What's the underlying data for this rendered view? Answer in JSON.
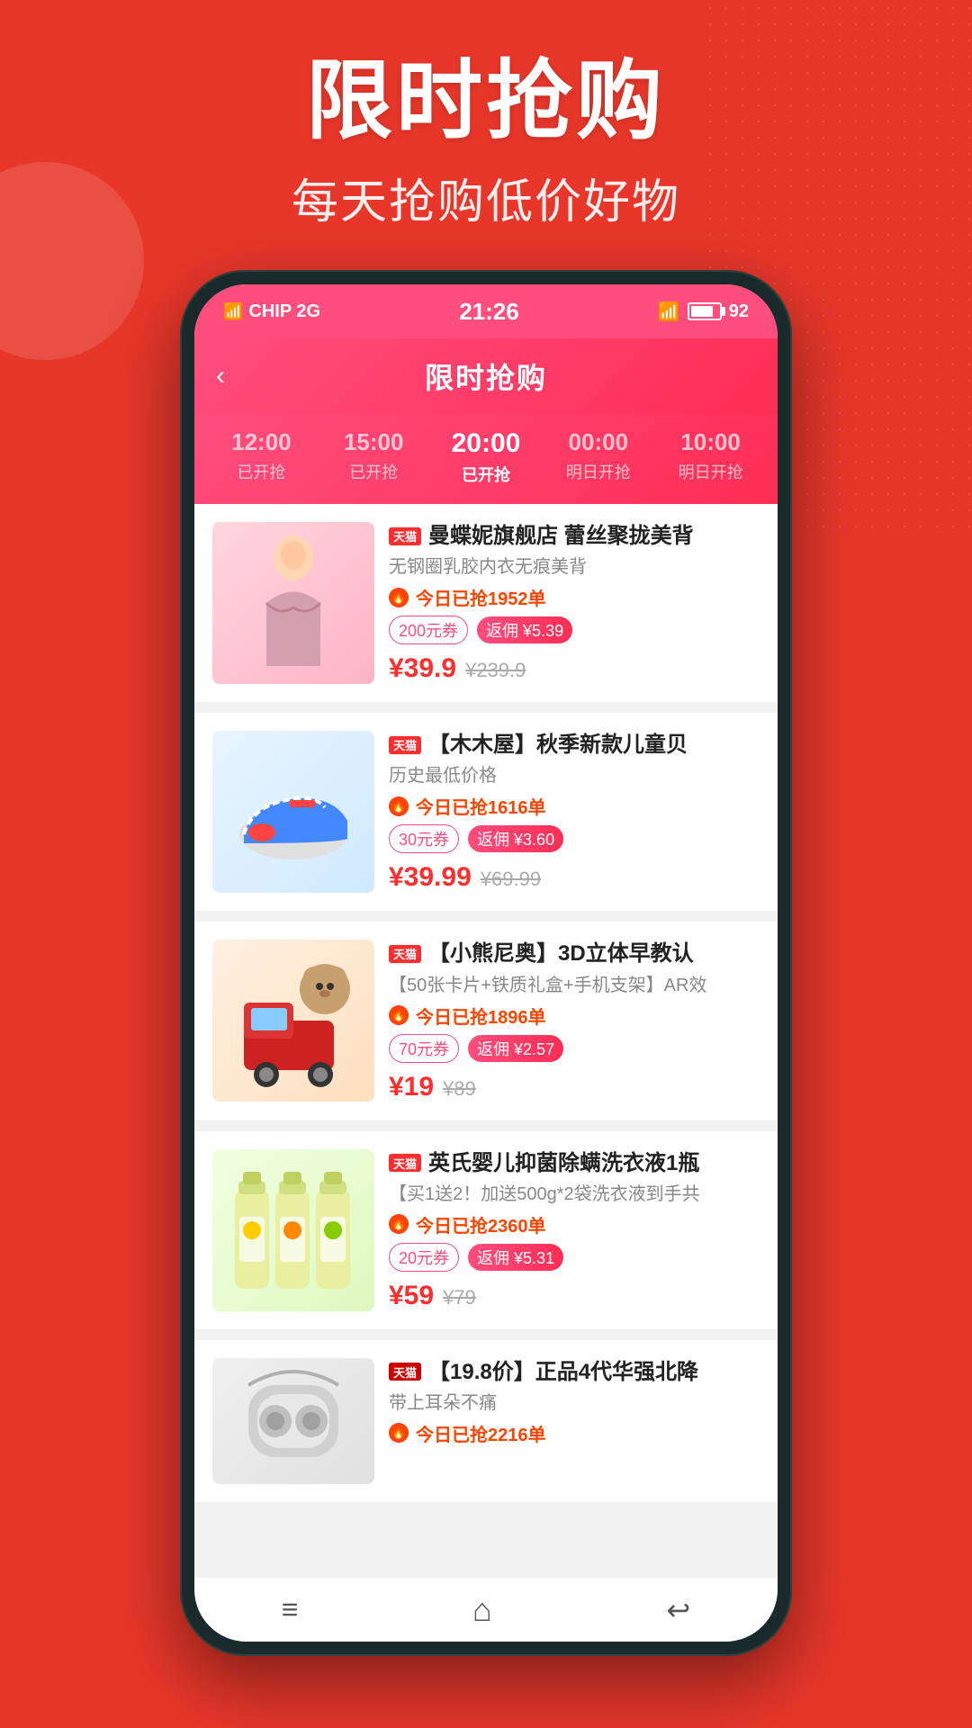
{
  "hero": {
    "title": "限时抢购",
    "subtitle": "每天抢购低价好物"
  },
  "status_bar": {
    "carrier": "CHIP 2G",
    "time": "21:26",
    "wifi": "WiFi",
    "battery": "92"
  },
  "header": {
    "back_label": "‹",
    "title": "限时抢购"
  },
  "time_tabs": [
    {
      "time": "12:00",
      "status": "已开抢",
      "active": false
    },
    {
      "time": "15:00",
      "status": "已开抢",
      "active": false
    },
    {
      "time": "20:00",
      "status": "已开抢",
      "active": true
    },
    {
      "time": "00:00",
      "status": "明日开抢",
      "active": false
    },
    {
      "time": "10:00",
      "status": "明日开抢",
      "active": false
    }
  ],
  "products": [
    {
      "store": "天猫",
      "name": "曼蝶妮旗舰店  蕾丝聚拢美背",
      "desc": "无钢圈乳胶内衣无痕美背",
      "flash_count": "今日已抢1952单",
      "tag1": "200元券",
      "cashback": "返佣 ¥5.39",
      "price": "¥39.9",
      "original_price": "¥239.9",
      "image_type": "bra",
      "image_emoji": "👙"
    },
    {
      "store": "天猫",
      "name": "【木木屋】秋季新款儿童贝",
      "desc": "历史最低价格",
      "flash_count": "今日已抢1616单",
      "tag1": "30元券",
      "cashback": "返佣 ¥3.60",
      "price": "¥39.99",
      "original_price": "¥69.99",
      "image_type": "shoes",
      "image_emoji": "👟"
    },
    {
      "store": "天猫",
      "name": "【小熊尼奥】3D立体早教认",
      "desc": "【50张卡片+铁质礼盒+手机支架】AR效",
      "flash_count": "今日已抢1896单",
      "tag1": "70元券",
      "cashback": "返佣 ¥2.57",
      "price": "¥19",
      "original_price": "¥89",
      "image_type": "bear",
      "image_emoji": "🧸"
    },
    {
      "store": "天猫",
      "name": "英氏婴儿抑菌除螨洗衣液1瓶",
      "desc": "【买1送2！加送500g*2袋洗衣液到手共",
      "flash_count": "今日已抢2360单",
      "tag1": "20元券",
      "cashback": "返佣 ¥5.31",
      "price": "¥59",
      "original_price": "¥79",
      "image_type": "detergent",
      "image_emoji": "🧴"
    },
    {
      "store": "天猫",
      "name": "【19.8价】正品4代华强北降",
      "desc": "带上耳朵不痛",
      "flash_count": "今日已抢2216单",
      "tag1": "",
      "cashback": "",
      "price": "",
      "original_price": "",
      "image_type": "earbuds",
      "image_emoji": "🎧"
    }
  ],
  "bottom_nav": {
    "menu_icon": "≡",
    "home_icon": "⌂",
    "back_icon": "↩"
  }
}
